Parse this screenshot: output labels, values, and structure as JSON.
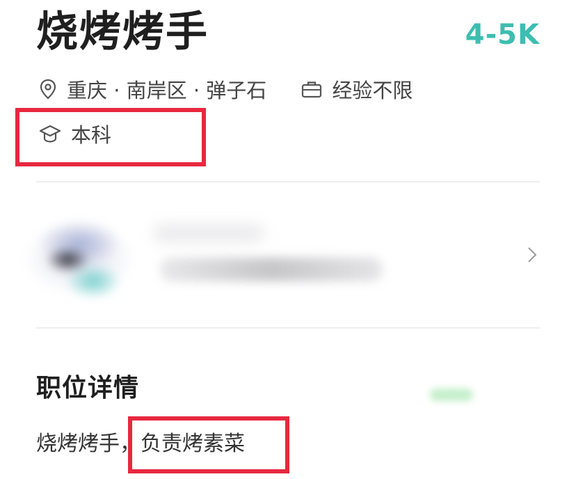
{
  "job": {
    "title": "烧烤烤手",
    "salary": "4-5K",
    "location": "重庆 · 南岸区 · 弹子石",
    "experience": "经验不限",
    "education": "本科"
  },
  "details": {
    "heading": "职位详情",
    "description_prefix": "烧烤烤手，",
    "description_highlight": "负责烤素菜"
  },
  "icons": {
    "location": "location-pin-icon",
    "experience": "briefcase-icon",
    "education": "graduation-cap-icon",
    "arrow": "chevron-right-icon"
  },
  "colors": {
    "salary": "#3dbdb1",
    "highlight_box": "#e8283f",
    "divider": "#eeeeee",
    "title": "#1f1f1f"
  }
}
